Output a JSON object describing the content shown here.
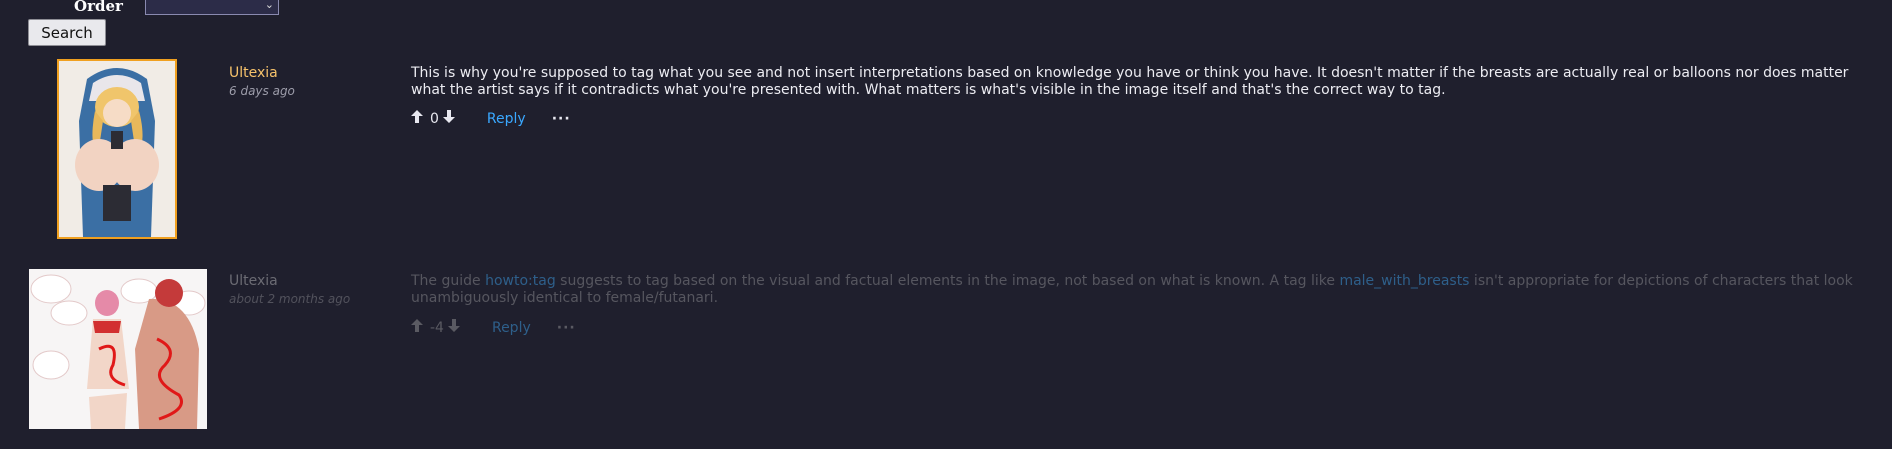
{
  "order": {
    "label": "Order",
    "value": ""
  },
  "search": {
    "label": "Search"
  },
  "comments": [
    {
      "author": "Ultexia",
      "timestamp": "6 days ago",
      "body": "This is why you're supposed to tag what you see and not insert interpretations based on knowledge you have or think you have. It doesn't matter if the breasts are actually real or balloons nor does matter what the artist says if it contradicts what you're presented with. What matters is what's visible in the image itself and that's the correct way to tag.",
      "score": "0",
      "reply": "Reply",
      "more": "···"
    },
    {
      "author": "Ultexia",
      "timestamp": "about 2 months ago",
      "body_part1": "The guide ",
      "link1": "howto:tag",
      "body_part2": " suggests to tag based on the visual and factual elements in the image, not based on what is known. A tag like ",
      "link2": "male_with_breasts",
      "body_part3": " isn't appropriate for depictions of characters that look unambiguously identical to female/futanari.",
      "score": "-4",
      "reply": "Reply",
      "more": "···"
    }
  ],
  "colors": {
    "background": "#1f1f2d",
    "author": "#f6c26b",
    "link": "#3aa8ff",
    "thumb_border": "#f0a020"
  },
  "icons": {
    "upvote": "arrow-up-icon",
    "downvote": "arrow-down-icon",
    "more": "ellipsis-icon",
    "select": "chevron-down-icon"
  }
}
